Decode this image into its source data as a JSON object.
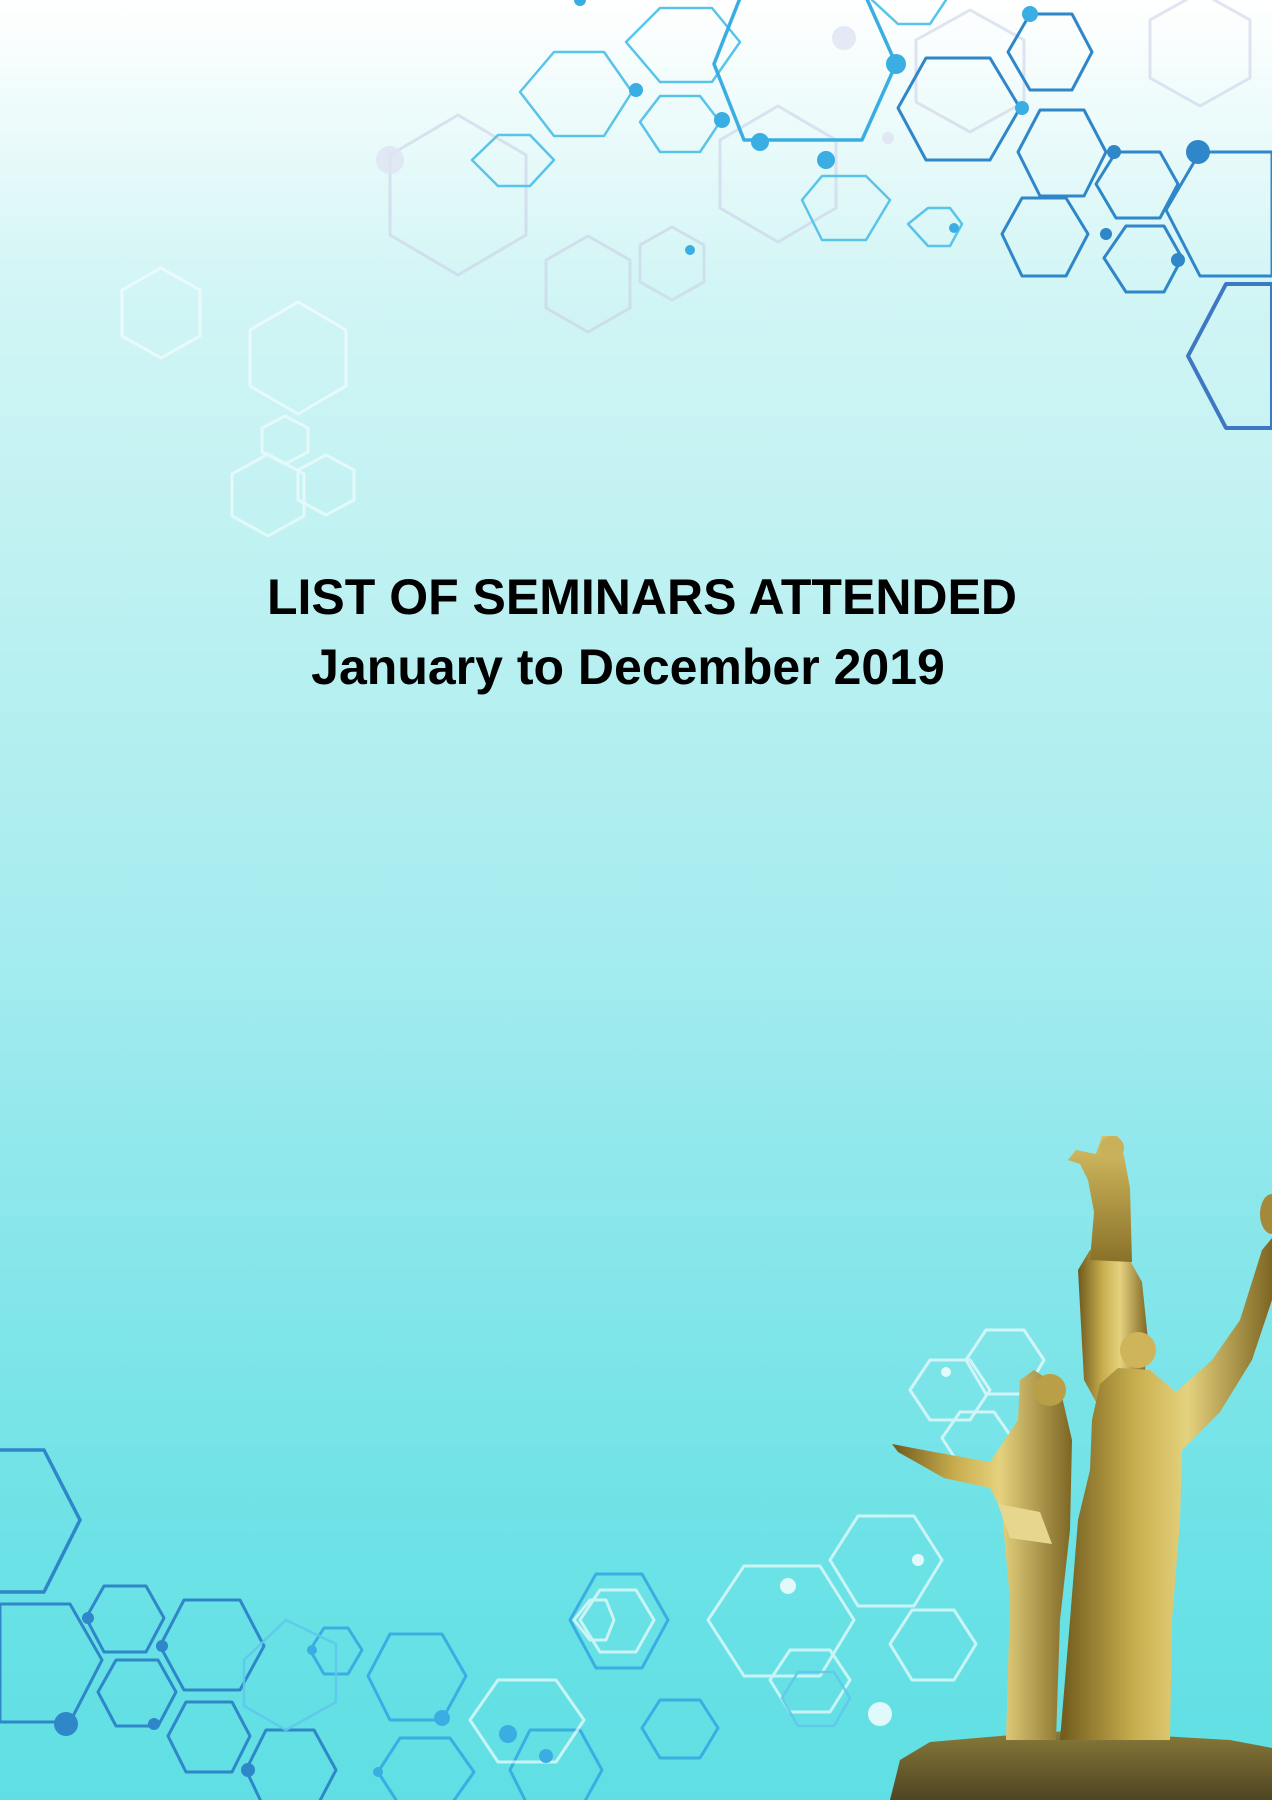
{
  "cover": {
    "heading": "LIST OF SEMINARS ATTENDED",
    "period": "January to December 2019"
  },
  "colors": {
    "hex_dark_blue": "#2b7fc4",
    "hex_light_blue": "#4cc3ea",
    "statue_gold": "#b89a3a"
  },
  "icons": {
    "decoration": "hexagon-network-pattern",
    "illustration": "golden-monument-statue"
  }
}
